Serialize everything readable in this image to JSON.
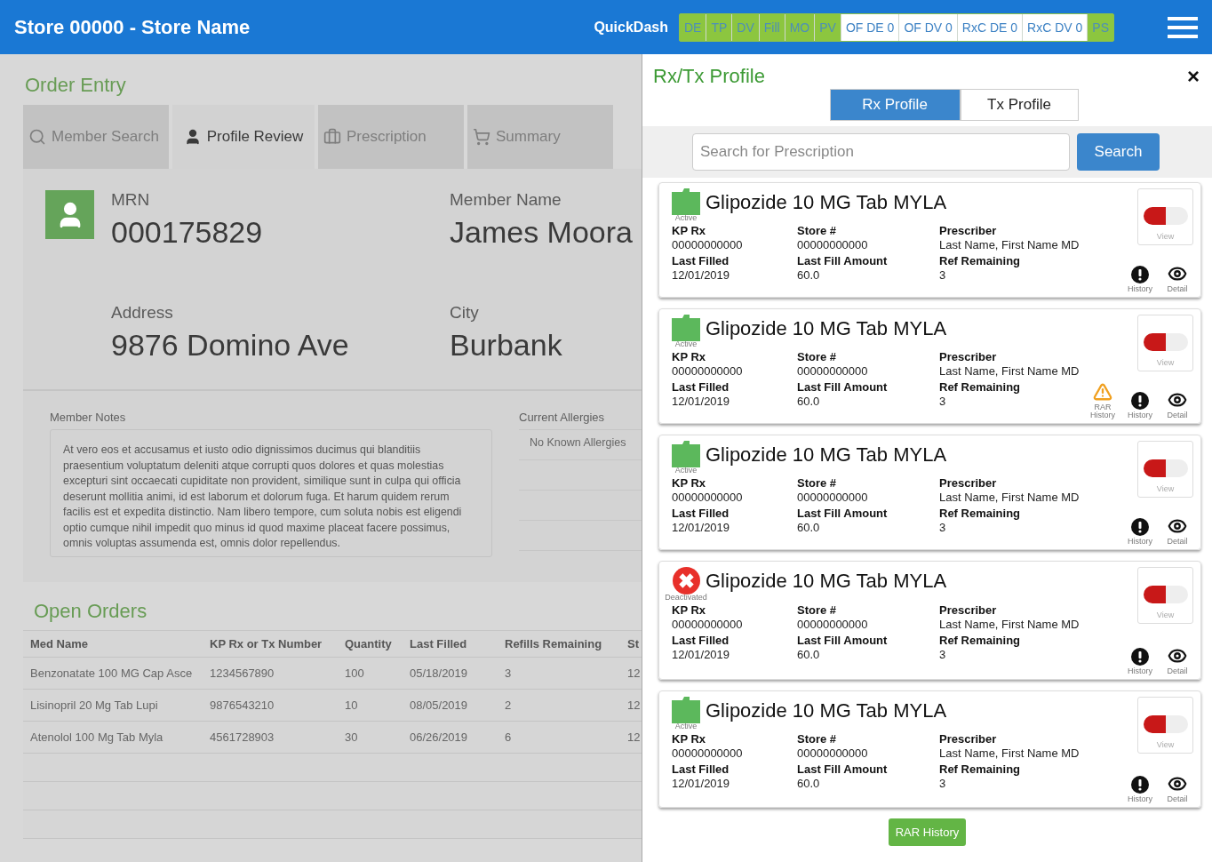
{
  "header": {
    "title": "Store 00000 - Store Name",
    "quickdash_label": "QuickDash",
    "quickdash": [
      {
        "label": "DE",
        "on": true
      },
      {
        "label": "TP",
        "on": true
      },
      {
        "label": "DV",
        "on": true
      },
      {
        "label": "Fill",
        "on": true
      },
      {
        "label": "MO",
        "on": true
      },
      {
        "label": "PV",
        "on": true
      },
      {
        "label": "OF DE 0",
        "on": false
      },
      {
        "label": "OF DV 0",
        "on": false
      },
      {
        "label": "RxC DE 0",
        "on": false
      },
      {
        "label": "RxC DV 0",
        "on": false
      },
      {
        "label": "PS",
        "on": true
      }
    ]
  },
  "order_entry": {
    "title": "Order Entry",
    "tabs": [
      {
        "kind": "search",
        "label": "Member Search",
        "selected": false
      },
      {
        "kind": "person",
        "label": "Profile Review",
        "selected": true
      },
      {
        "kind": "briefcase",
        "label": "Prescription",
        "selected": false
      },
      {
        "kind": "cart",
        "label": "Summary",
        "selected": false
      }
    ]
  },
  "member": {
    "fields": [
      {
        "label": "MRN",
        "value": "000175829"
      },
      {
        "label": "Member Name",
        "value": "James Moora"
      },
      {
        "label": "Address",
        "value": "9876 Domino Ave"
      },
      {
        "label": "City",
        "value": "Burbank"
      }
    ]
  },
  "notes": {
    "label": "Member Notes",
    "text": "At vero eos et accusamus et iusto odio dignissimos ducimus qui blanditiis praesentium voluptatum deleniti atque corrupti quos dolores et quas molestias excepturi sint occaecati cupiditate non provident, similique sunt in culpa qui officia deserunt mollitia animi, id est laborum et dolorum fuga. Et harum quidem rerum facilis est et expedita distinctio. Nam libero tempore, cum soluta nobis est eligendi optio cumque nihil impedit quo minus id quod maxime placeat facere possimus, omnis voluptas assumenda est, omnis dolor repellendus."
  },
  "allergies": {
    "label": "Current Allergies",
    "items": [
      "No Known Allergies"
    ]
  },
  "open_orders": {
    "title": "Open Orders",
    "columns": [
      "Med Name",
      "KP Rx or Tx Number",
      "Quantity",
      "Last Filled",
      "Refills Remaining",
      "St"
    ],
    "rows": [
      [
        "Benzonatate 100 MG Cap Asce",
        "1234567890",
        "100",
        "05/18/2019",
        "3",
        "12"
      ],
      [
        "Lisinopril 20 Mg Tab Lupi",
        "9876543210",
        "10",
        "08/05/2019",
        "2",
        "12"
      ],
      [
        "Atenolol 100 Mg Tab Myla",
        "4561728903",
        "30",
        "06/26/2019",
        "6",
        "12"
      ]
    ]
  },
  "rx_panel": {
    "title": "Rx/Tx Profile",
    "close": "×",
    "tabs": [
      {
        "label": "Rx Profile",
        "selected": true
      },
      {
        "label": "Tx Profile",
        "selected": false
      }
    ],
    "search": {
      "placeholder": "Search for Prescription",
      "button": "Search"
    },
    "cards": [
      {
        "kind": "active",
        "status_label": "Active",
        "name": "Glipozide 10 MG Tab MYLA",
        "fields": [
          {
            "label": "KP Rx",
            "value": "00000000000"
          },
          {
            "label": "Store #",
            "value": "00000000000"
          },
          {
            "label": "Prescriber",
            "value": "Last Name, First Name MD"
          },
          {
            "label": "Last Filled",
            "value": "12/01/2019"
          },
          {
            "label": "Last Fill Amount",
            "value": "60.0"
          },
          {
            "label": "Ref Remaining",
            "value": "3"
          }
        ],
        "view_label": "View",
        "actions": [
          {
            "kind": "history",
            "label": "History"
          },
          {
            "kind": "detail",
            "label": "Detail"
          }
        ]
      },
      {
        "kind": "active",
        "status_label": "Active",
        "name": "Glipozide 10 MG Tab MYLA",
        "fields": [
          {
            "label": "KP Rx",
            "value": "00000000000"
          },
          {
            "label": "Store #",
            "value": "00000000000"
          },
          {
            "label": "Prescriber",
            "value": "Last Name, First Name MD"
          },
          {
            "label": "Last Filled",
            "value": "12/01/2019"
          },
          {
            "label": "Last Fill Amount",
            "value": "60.0"
          },
          {
            "label": "Ref Remaining",
            "value": "3"
          }
        ],
        "view_label": "View",
        "actions": [
          {
            "kind": "rar",
            "label": "RAR History"
          },
          {
            "kind": "history",
            "label": "History"
          },
          {
            "kind": "detail",
            "label": "Detail"
          }
        ]
      },
      {
        "kind": "active",
        "status_label": "Active",
        "name": "Glipozide 10 MG Tab MYLA",
        "fields": [
          {
            "label": "KP Rx",
            "value": "00000000000"
          },
          {
            "label": "Store #",
            "value": "00000000000"
          },
          {
            "label": "Prescriber",
            "value": "Last Name, First Name MD"
          },
          {
            "label": "Last Filled",
            "value": "12/01/2019"
          },
          {
            "label": "Last Fill Amount",
            "value": "60.0"
          },
          {
            "label": "Ref Remaining",
            "value": "3"
          }
        ],
        "view_label": "View",
        "actions": [
          {
            "kind": "history",
            "label": "History"
          },
          {
            "kind": "detail",
            "label": "Detail"
          }
        ]
      },
      {
        "kind": "deactivated",
        "status_label": "Deactivated",
        "name": "Glipozide 10 MG Tab MYLA",
        "fields": [
          {
            "label": "KP Rx",
            "value": "00000000000"
          },
          {
            "label": "Store #",
            "value": "00000000000"
          },
          {
            "label": "Prescriber",
            "value": "Last Name, First Name MD"
          },
          {
            "label": "Last Filled",
            "value": "12/01/2019"
          },
          {
            "label": "Last Fill Amount",
            "value": "60.0"
          },
          {
            "label": "Ref Remaining",
            "value": "3"
          }
        ],
        "view_label": "View",
        "actions": [
          {
            "kind": "history",
            "label": "History"
          },
          {
            "kind": "detail",
            "label": "Detail"
          }
        ]
      },
      {
        "kind": "active",
        "status_label": "Active",
        "name": "Glipozide 10 MG Tab MYLA",
        "fields": [
          {
            "label": "KP Rx",
            "value": "00000000000"
          },
          {
            "label": "Store #",
            "value": "00000000000"
          },
          {
            "label": "Prescriber",
            "value": "Last Name, First Name MD"
          },
          {
            "label": "Last Filled",
            "value": "12/01/2019"
          },
          {
            "label": "Last Fill Amount",
            "value": "60.0"
          },
          {
            "label": "Ref Remaining",
            "value": "3"
          }
        ],
        "view_label": "View",
        "actions": [
          {
            "kind": "history",
            "label": "History"
          },
          {
            "kind": "detail",
            "label": "Detail"
          }
        ]
      }
    ],
    "rar_button": "RAR History"
  }
}
